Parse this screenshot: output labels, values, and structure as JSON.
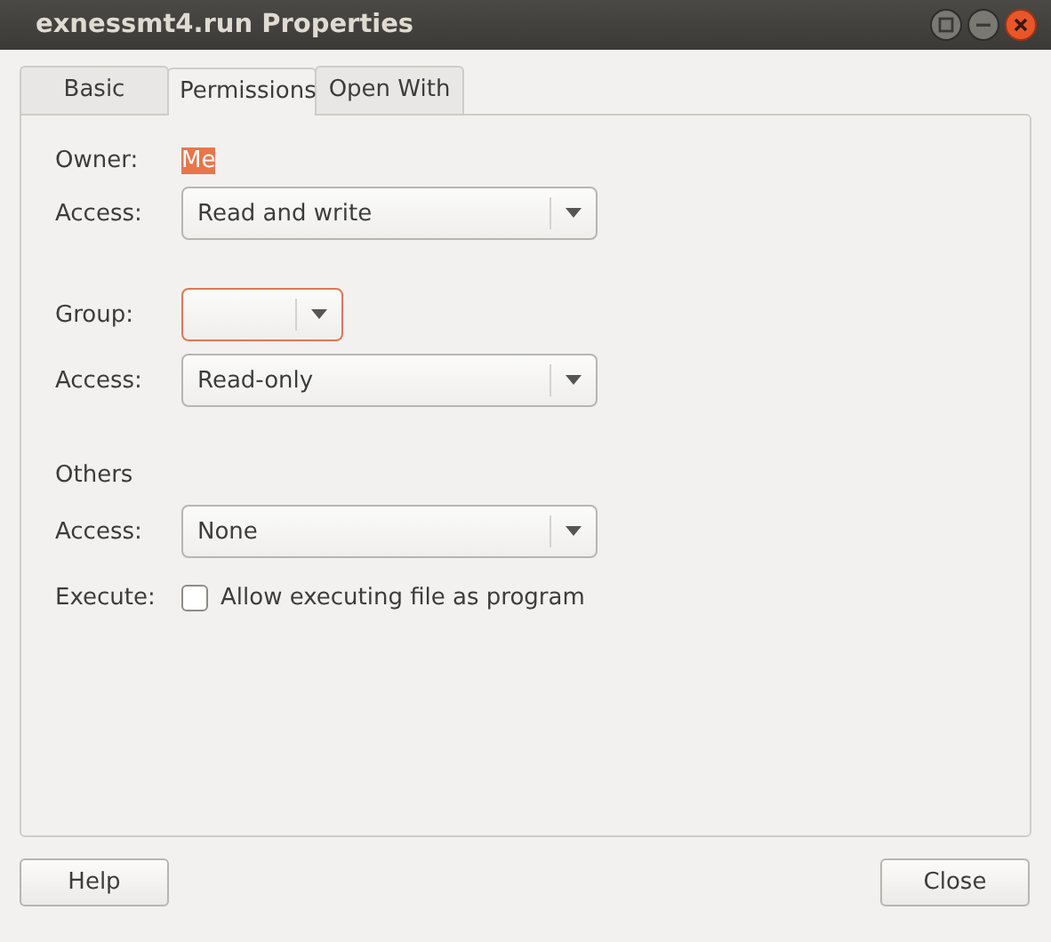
{
  "window": {
    "title": "exnessmt4.run Properties"
  },
  "tabs": [
    {
      "label": "Basic",
      "selected": false
    },
    {
      "label": "Permissions",
      "selected": true
    },
    {
      "label": "Open With",
      "selected": false
    }
  ],
  "permissions": [
    {
      "kind": "value",
      "label": "Owner:",
      "value": "Me",
      "selected": true
    },
    {
      "kind": "combo",
      "label": "Access:",
      "value": "Read and write",
      "focused": false
    },
    {
      "kind": "gap"
    },
    {
      "kind": "combo",
      "label": "Group:",
      "focused": true,
      "narrow": true
    },
    {
      "kind": "combo",
      "label": "Access:",
      "value": "Read-only",
      "focused": false
    },
    {
      "kind": "gap"
    },
    {
      "kind": "heading",
      "label": "Others"
    },
    {
      "kind": "combo",
      "label": "Access:",
      "value": "None",
      "focused": false
    },
    {
      "kind": "check",
      "label": "Execute:",
      "value": "Allow executing file as program",
      "checked": false
    }
  ],
  "buttons": [
    "Help",
    "Close"
  ]
}
